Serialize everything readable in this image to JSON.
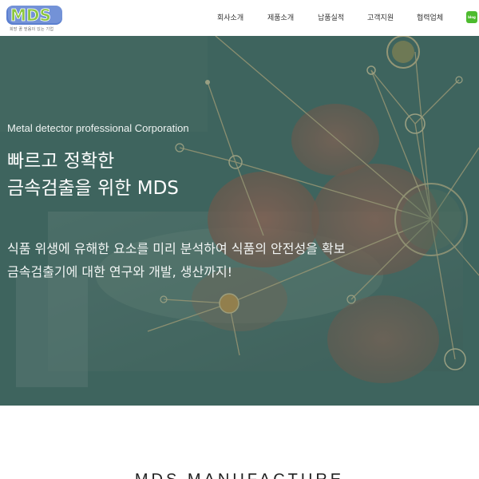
{
  "header": {
    "logo_text": "MDS",
    "logo_tagline": "희망 꿈 믿음이 있는 기업",
    "nav": [
      "회사소개",
      "제품소개",
      "납품실적",
      "고객지원",
      "협력업체"
    ],
    "blog_label": "blog"
  },
  "hero": {
    "subtitle": "Metal detector professional Corporation",
    "title_line1": "빠르고 정확한",
    "title_line2": "금속검출을 위한 MDS",
    "desc_line1": "식품 위생에 유해한 요소를 미리 분석하여 식품의 안전성을 확보",
    "desc_line2": "금속검출기에 대한 연구와 개발, 생산까지!"
  },
  "section": {
    "title": "MDS MANUFACTURE"
  },
  "colors": {
    "logo_m": "#7ab83a",
    "logo_d": "#e8a21a",
    "logo_s": "#2f7fc4",
    "hero_overlay": "#2e5e56",
    "network_line": "#e0b070",
    "blog_green": "#4dbb2e"
  },
  "icons": [
    "network-graphic",
    "blog-icon"
  ]
}
